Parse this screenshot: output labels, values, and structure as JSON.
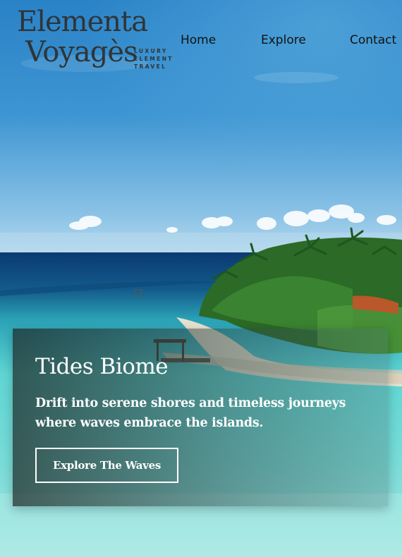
{
  "brand": {
    "name_line1": "Elementa",
    "name_line2": "Voyagès",
    "tagline": [
      "LUXURY",
      "ELEMENT",
      "TRAVEL"
    ]
  },
  "nav": {
    "items": [
      {
        "label": "Home"
      },
      {
        "label": "Explore"
      },
      {
        "label": "Contact"
      }
    ]
  },
  "hero": {
    "title": "Tides Biome",
    "description": "Drift into serene shores and timeless journeys where waves embrace the islands.",
    "cta_label": "Explore The Waves"
  },
  "colors": {
    "sky_top": "#1f7fc4",
    "sky_bottom": "#a8d4ee",
    "ocean_deep": "#0b3a6e",
    "lagoon": "#4fd0cf",
    "sand": "#e8e0cf",
    "palm": "#2f6b2a",
    "logo_text": "#2f3538",
    "cta_border": "#ffffff"
  }
}
